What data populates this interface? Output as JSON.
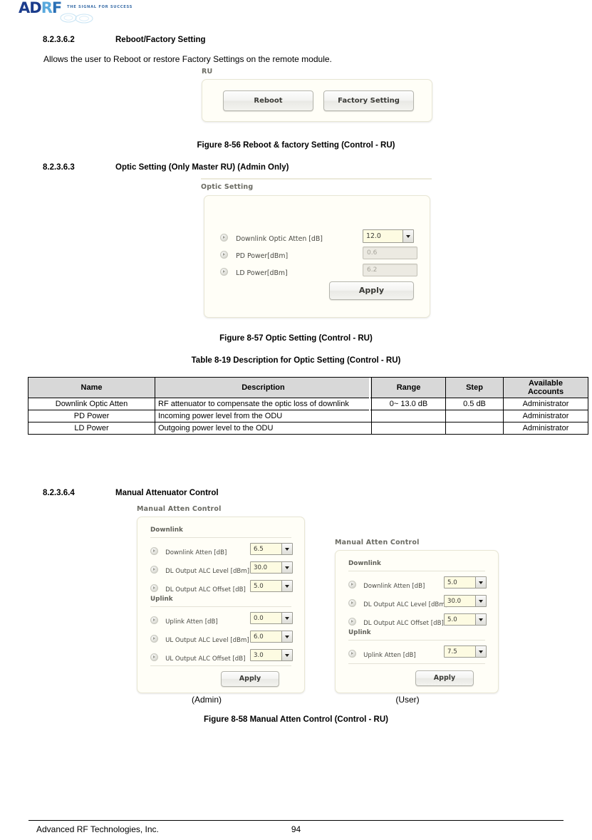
{
  "header": {
    "logo_text": "ADRF",
    "logo_tagline": "THE SIGNAL FOR SUCCESS"
  },
  "sections": [
    {
      "number": "8.2.3.6.2",
      "title": "Reboot/Factory Setting"
    },
    {
      "number": "8.2.3.6.3",
      "title": "Optic Setting (Only Master RU) (Admin Only)"
    },
    {
      "number": "8.2.3.6.4",
      "title": "Manual Attenuator Control"
    }
  ],
  "paragraph": "Allows the user to Reboot or restore Factory Settings on the remote module.",
  "figures": {
    "fig_8_56": "Figure 8-56   Reboot & factory Setting (Control - RU)",
    "fig_8_57": "Figure 8-57   Optic Setting (Control - RU)",
    "fig_8_58": "Figure 8-58   Manual Atten Control (Control - RU)"
  },
  "table_caption": "Table 8-19    Description for Optic Setting (Control - RU)",
  "ru_panel": {
    "title": "RU",
    "reboot_label": "Reboot",
    "factory_label": "Factory Setting"
  },
  "optic_panel": {
    "title": "Optic Setting",
    "rows": [
      {
        "label": "Downlink Optic Atten [dB]",
        "value": "12.0",
        "type": "combo"
      },
      {
        "label": "PD Power[dBm]",
        "value": "0.6",
        "type": "readonly"
      },
      {
        "label": "LD Power[dBm]",
        "value": "6.2",
        "type": "readonly"
      }
    ],
    "apply_label": "Apply"
  },
  "optic_table": {
    "headers": [
      "Name",
      "Description",
      "Range",
      "Step",
      "Available\nAccounts"
    ],
    "header_name": "Name",
    "header_description": "Description",
    "header_range": "Range",
    "header_step": "Step",
    "header_available": "Available",
    "header_accounts": "Accounts",
    "rows": [
      {
        "name": "Downlink Optic Atten",
        "description": "RF attenuator to compensate the optic loss of downlink",
        "range": "0~ 13.0 dB",
        "step": "0.5 dB",
        "accounts": "Administrator"
      },
      {
        "name": "PD Power",
        "description": "Incoming power level from the ODU",
        "range": "",
        "step": "",
        "accounts": "Administrator"
      },
      {
        "name": "LD Power",
        "description": "Outgoing power level to the ODU",
        "range": "",
        "step": "",
        "accounts": "Administrator"
      }
    ]
  },
  "manual_admin": {
    "title": "Manual Atten Control",
    "caption": "(Admin)",
    "downlink_label": "Downlink",
    "uplink_label": "Uplink",
    "apply_label": "Apply",
    "downlink_rows": [
      {
        "label": "Downlink Atten [dB]",
        "value": "6.5"
      },
      {
        "label": "DL Output ALC Level [dBm]",
        "value": "30.0"
      },
      {
        "label": "DL Output ALC Offset [dB]",
        "value": "5.0"
      }
    ],
    "uplink_rows": [
      {
        "label": "Uplink Atten [dB]",
        "value": "0.0"
      },
      {
        "label": "UL Output ALC Level [dBm]",
        "value": "6.0"
      },
      {
        "label": "UL Output ALC Offset [dB]",
        "value": "3.0"
      }
    ]
  },
  "manual_user": {
    "title": "Manual Atten Control",
    "caption": "(User)",
    "downlink_label": "Downlink",
    "uplink_label": "Uplink",
    "apply_label": "Apply",
    "downlink_rows": [
      {
        "label": "Downlink Atten [dB]",
        "value": "5.0"
      },
      {
        "label": "DL Output ALC Level [dBm]",
        "value": "30.0"
      },
      {
        "label": "DL Output ALC Offset [dB]",
        "value": "5.0"
      }
    ],
    "uplink_rows": [
      {
        "label": "Uplink Atten [dB]",
        "value": "7.5"
      }
    ]
  },
  "footer": {
    "company": "Advanced RF Technologies, Inc.",
    "page": "94"
  },
  "colors": {
    "combo_bg": "#fdfbe2",
    "panel_bg": "#fffef7",
    "table_header_bg": "#d8d8d8",
    "logo_blue": "#1b3c8c",
    "logo_light": "#5aa9dd"
  }
}
